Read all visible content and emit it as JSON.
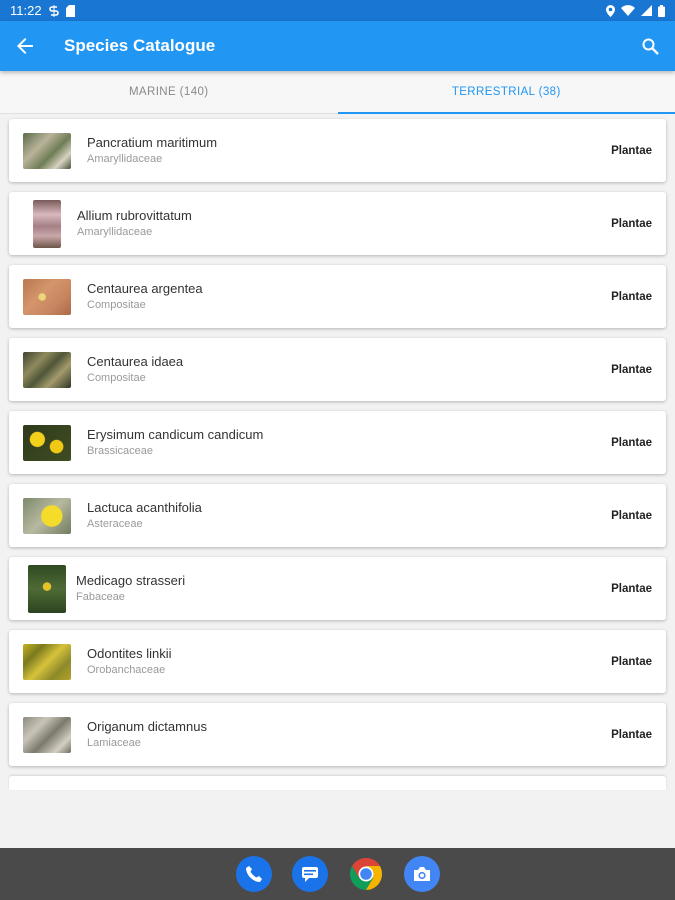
{
  "status_bar": {
    "time": "11:22",
    "left_icons": [
      "s-badge-icon",
      "sd-card-icon"
    ],
    "right_icons": [
      "location-icon",
      "wifi-icon",
      "cell-signal-icon",
      "battery-icon"
    ]
  },
  "app_bar": {
    "title": "Species Catalogue",
    "back_icon": "arrow-back-icon",
    "search_icon": "search-icon"
  },
  "tabs": [
    {
      "label": "MARINE (140)",
      "active": false
    },
    {
      "label": "TERRESTRIAL (38)",
      "active": true
    }
  ],
  "species": [
    {
      "name": "Pancratium maritimum",
      "family": "Amaryllidaceae",
      "kingdom": "Plantae"
    },
    {
      "name": "Allium rubrovittatum",
      "family": "Amaryllidaceae",
      "kingdom": "Plantae"
    },
    {
      "name": "Centaurea argentea",
      "family": "Compositae",
      "kingdom": "Plantae"
    },
    {
      "name": "Centaurea idaea",
      "family": "Compositae",
      "kingdom": "Plantae"
    },
    {
      "name": "Erysimum candicum candicum",
      "family": "Brassicaceae",
      "kingdom": "Plantae"
    },
    {
      "name": "Lactuca acanthifolia",
      "family": "Asteraceae",
      "kingdom": "Plantae"
    },
    {
      "name": "Medicago strasseri",
      "family": "Fabaceae",
      "kingdom": "Plantae"
    },
    {
      "name": "Odontites linkii",
      "family": "Orobanchaceae",
      "kingdom": "Plantae"
    },
    {
      "name": "Origanum dictamnus",
      "family": "Lamiaceae",
      "kingdom": "Plantae"
    }
  ],
  "dock": [
    "phone-app-icon",
    "messages-app-icon",
    "chrome-app-icon",
    "camera-app-icon"
  ],
  "colors": {
    "primary": "#2196f3",
    "status_bar": "#1976d2",
    "nav_bar": "#4a4a4a"
  }
}
